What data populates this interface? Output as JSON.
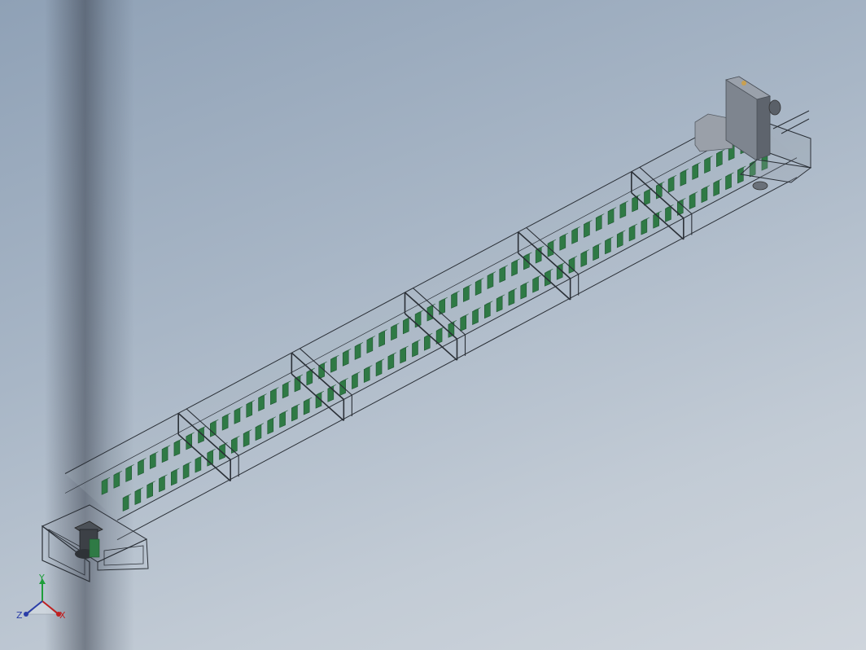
{
  "viewport": {
    "background_top": "#8fa1b6",
    "background_bottom": "#cfd5dc"
  },
  "model": {
    "frame_color": "#2a2f36",
    "flight_color": "#2f7a45",
    "flight_dark": "#1f5631",
    "drive_housing_color": "#6c7480",
    "flight_count_per_row": 54,
    "segment_count": 6
  },
  "triad": {
    "x_label": "X",
    "y_label": "Y",
    "z_label": "Z",
    "x_color": "#c02020",
    "y_color": "#1e9e3a",
    "z_color": "#2a3da8"
  }
}
